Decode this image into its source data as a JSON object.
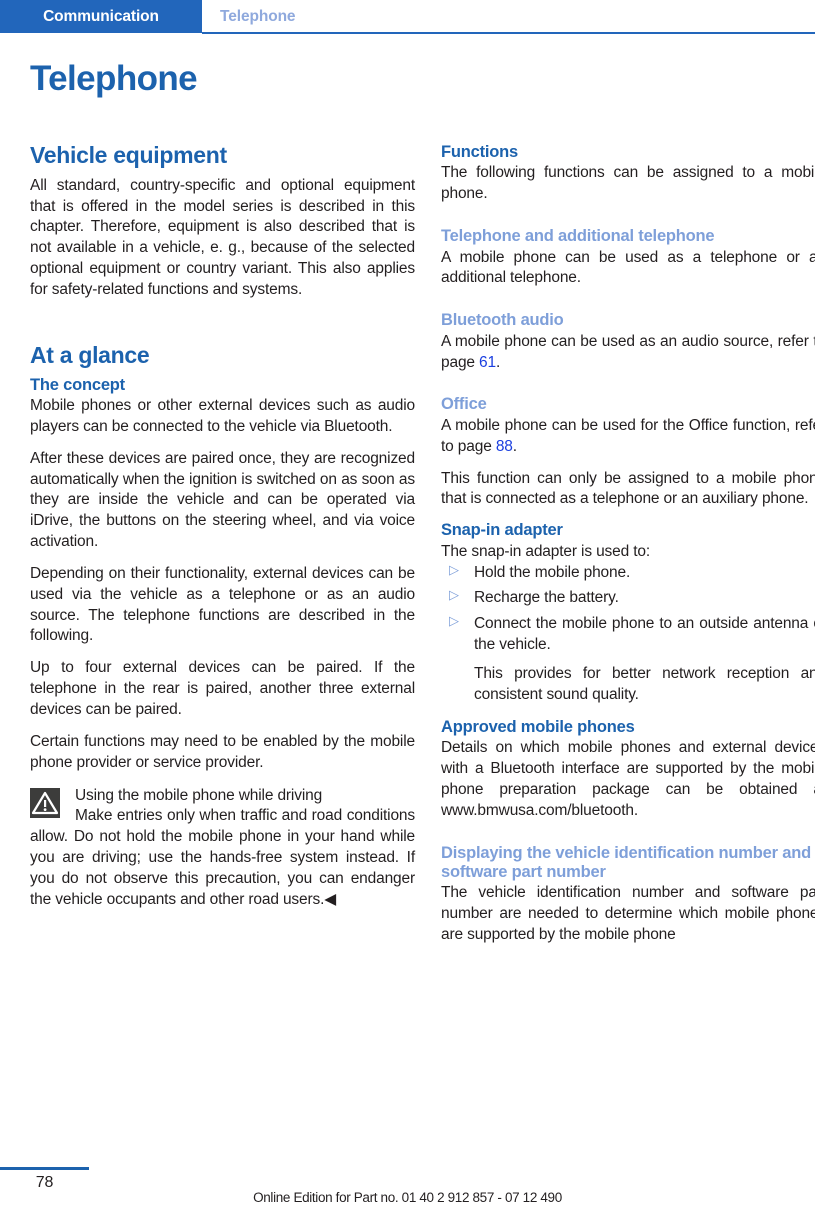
{
  "header": {
    "chapter": "Communication",
    "section": "Telephone"
  },
  "page_title": "Telephone",
  "colors": {
    "header_band": "#2266bb",
    "heading_primary": "#1c62ad",
    "heading_secondary": "#7e9fd9",
    "page_reference_link": "#1b3fe0",
    "body_text": "#231f20",
    "warning_icon_bg": "#3c3c3b"
  },
  "left_column": {
    "vehicle_equipment": {
      "heading": "Vehicle equipment",
      "paragraph": "All standard, country-specific and optional equipment that is offered in the model series is described in this chapter. Therefore, equipment is also described that is not available in a vehicle, e. g., because of the selected optional equipment or country variant. This also applies for safety-related functions and systems."
    },
    "at_a_glance": {
      "heading": "At a glance",
      "concept": {
        "heading": "The concept",
        "paragraphs": [
          "Mobile phones or other external devices such as audio players can be connected to the vehicle via Bluetooth.",
          "After these devices are paired once, they are recognized automatically when the ignition is switched on as soon as they are inside the vehicle and can be operated via iDrive, the buttons on the steering wheel, and via voice activation.",
          "Depending on their functionality, external devices can be used via the vehicle as a telephone or as an audio source. The telephone functions are described in the following.",
          "Up to four external devices can be paired. If the telephone in the rear is paired, another three external devices can be paired.",
          "Certain functions may need to be enabled by the mobile phone provider or service provider."
        ]
      },
      "warning": {
        "icon": "warning-triangle-icon",
        "title": "Using the mobile phone while driving",
        "body": "Make entries only when traffic and road conditions allow. Do not hold the mobile phone in your hand while you are driving; use the hands-free system instead. If you do not observe this precaution, you can endanger the vehicle occupants and other road users.",
        "end_mark": "◀"
      }
    }
  },
  "right_column": {
    "functions": {
      "heading": "Functions",
      "intro": "The following functions can be assigned to a mobile phone.",
      "subsections": [
        {
          "heading": "Telephone and additional telephone",
          "paragraphs": [
            "A mobile phone can be used as a telephone or an additional telephone."
          ]
        },
        {
          "heading": "Bluetooth audio",
          "text_before_ref": "A mobile phone can be used as an audio source, refer to page ",
          "page_ref": "61",
          "text_after_ref": "."
        },
        {
          "heading": "Office",
          "text_before_ref": "A mobile phone can be used for the Office function, refer to page ",
          "page_ref": "88",
          "text_after_ref": ".",
          "extra_paragraph": "This function can only be assigned to a mobile phone that is connected as a telephone or an auxiliary phone."
        }
      ]
    },
    "snap_in_adapter": {
      "heading": "Snap-in adapter",
      "intro": "The snap-in adapter is used to:",
      "bullet_marker": "triangle-bullet-icon",
      "items": [
        "Hold the mobile phone.",
        "Recharge the battery.",
        "Connect the mobile phone to an outside antenna of the vehicle."
      ],
      "note": "This provides for better network reception and consistent sound quality."
    },
    "approved_mobile_phones": {
      "heading": "Approved mobile phones",
      "paragraph": "Details on which mobile phones and external devices with a Bluetooth interface are supported by the mobile phone preparation package can be obtained at www.bmwusa.com/bluetooth."
    },
    "displaying_vin": {
      "heading": "Displaying the vehicle identification number and software part number",
      "paragraph": "The vehicle identification number and software part number are needed to determine which mobile phones are supported by the mobile phone"
    }
  },
  "footer": {
    "page_number": "78",
    "edition_note": "Online Edition for Part no. 01 40 2 912 857 - 07 12 490"
  }
}
